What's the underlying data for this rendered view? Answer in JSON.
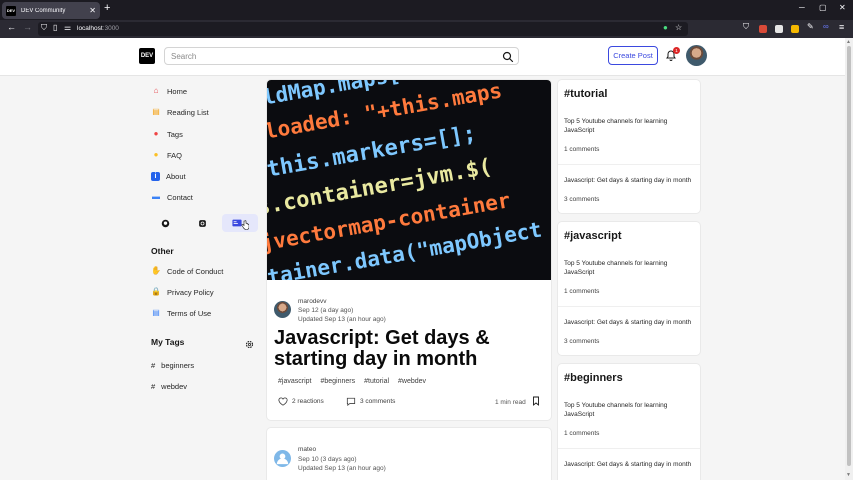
{
  "browser": {
    "tab_title": "DEV Community",
    "tab_favicon": "DEV",
    "url_host": "localhost",
    "url_port": ":3000"
  },
  "header": {
    "logo": "DEV",
    "search_placeholder": "Search",
    "create_post": "Create Post",
    "notification_count": "1"
  },
  "sidebar": {
    "nav": [
      {
        "label": "Home",
        "icon": "house-icon",
        "glyph": "⌂",
        "color": "#e5484d"
      },
      {
        "label": "Reading List",
        "icon": "books-icon",
        "glyph": "▤",
        "color": "#f59e0b"
      },
      {
        "label": "Tags",
        "icon": "tag-icon",
        "glyph": "●",
        "color": "#ef4444"
      },
      {
        "label": "FAQ",
        "icon": "lightbulb-icon",
        "glyph": "●",
        "color": "#fbbf24"
      },
      {
        "label": "About",
        "icon": "info-icon",
        "glyph": "i",
        "color": "#2563eb"
      },
      {
        "label": "Contact",
        "icon": "chat-icon",
        "glyph": "▬",
        "color": "#3b82f6"
      }
    ],
    "other_heading": "Other",
    "other": [
      {
        "label": "Code of Conduct",
        "icon": "thumbs-up-icon",
        "glyph": "👍",
        "color": "#f59e0b"
      },
      {
        "label": "Privacy Policy",
        "icon": "lock-icon",
        "glyph": "🔒",
        "color": "#f59e0b"
      },
      {
        "label": "Terms of Use",
        "icon": "document-icon",
        "glyph": "▤",
        "color": "#3b82f6"
      }
    ],
    "my_tags_heading": "My Tags",
    "my_tags": [
      "beginners",
      "webdev"
    ]
  },
  "feed": [
    {
      "author": "marodevv",
      "date": "Sep 12 (a day ago)",
      "updated": "Updated Sep 13 (an hour ago)",
      "title": "Javascript: Get days & starting day in month",
      "tags": [
        "#javascript",
        "#beginners",
        "#tutorial",
        "#webdev"
      ],
      "reactions": "2 reactions",
      "comments": "3 comments",
      "read_time": "1 min read"
    },
    {
      "author": "mateo",
      "date": "Sep 10 (3 days ago)",
      "updated": "Updated Sep 13 (an hour ago)"
    }
  ],
  "cover_code": [
    {
      "text": "ldMap.maps[this.",
      "color": "#7ec8ff"
    },
    {
      "text": " loaded: \"+this.maps",
      "color": "#ff7a3d"
    },
    {
      "text": "this.markers=[];",
      "color": "#7ec8ff"
    },
    {
      "text": "s.container=jvm.$(",
      "color": "#e9e9a0"
    },
    {
      "text": "jvectormap-container",
      "color": "#ff7a3d"
    },
    {
      "text": "ntainer.data(\"mapObject",
      "color": "#7ec8ff"
    }
  ],
  "right_column": [
    {
      "heading": "#tutorial",
      "items": [
        {
          "title": "Top 5 Youtube channels for learning JavaScript",
          "meta": "1 comments"
        },
        {
          "title": "Javascript: Get days & starting day in month",
          "meta": "3 comments"
        }
      ]
    },
    {
      "heading": "#javascript",
      "items": [
        {
          "title": "Top 5 Youtube channels for learning JavaScript",
          "meta": "1 comments"
        },
        {
          "title": "Javascript: Get days & starting day in month",
          "meta": "3 comments"
        }
      ]
    },
    {
      "heading": "#beginners",
      "items": [
        {
          "title": "Top 5 Youtube channels for learning JavaScript",
          "meta": "1 comments"
        },
        {
          "title": "Javascript: Get days & starting day in month",
          "meta": ""
        }
      ]
    }
  ]
}
